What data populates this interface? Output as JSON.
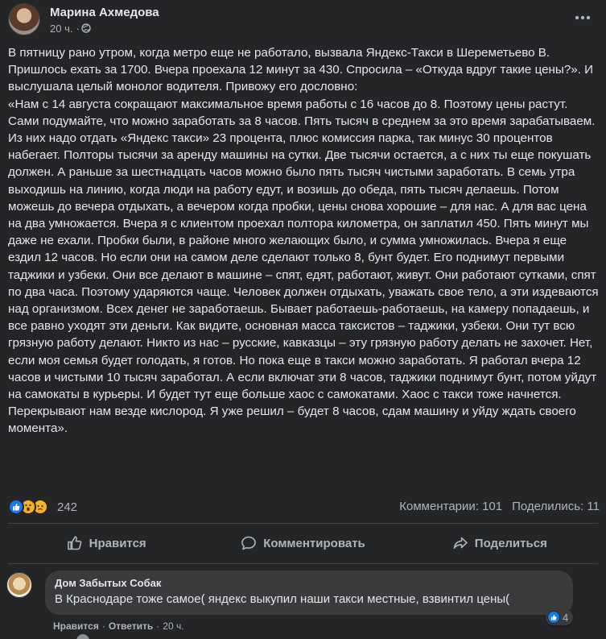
{
  "post": {
    "author": "Марина Ахмедова",
    "time": "20 ч.",
    "time_separator": "·",
    "more_icon": "more-horizontal-icon",
    "paragraphs": [
      "В пятницу рано утром, когда метро еще не работало, вызвала Яндекс-Такси в Шереметьево В. Пришлось ехать за 1700. Вчера проехала 12 минут за 430. Спросила – «Откуда вдруг такие цены?». И выслушала целый монолог водителя. Привожу его дословно:",
      "«Нам с 14 августа сокращают максимальное время работы с 16 часов до 8. Поэтому цены растут. Сами подумайте, что можно заработать за 8 часов. Пять тысяч в среднем за это время зарабатываем. Из них надо отдать «Яндекс такси» 23 процента, плюс комиссия парка, так минус 30 процентов набегает. Полторы тысячи за аренду машины на сутки. Две тысячи остается, а с них ты еще покушать должен. А раньше за шестнадцать часов можно было пять тысяч чистыми заработать. В семь утра выходишь на линию, когда люди на работу едут, и возишь до обеда, пять тысяч делаешь. Потом можешь до вечера отдыхать, а вечером когда пробки, цены снова хорошие – для нас. А для вас цена на два умножается. Вчера я с клиентом проехал полтора километра, он заплатил 450. Пять минут мы даже не ехали. Пробки были, в районе много желающих было, и сумма умножилась. Вчера я еще ездил 12 часов. Но если они на самом деле сделают только 8, бунт будет. Его поднимут первыми таджики и узбеки. Они все делают в машине – спят, едят, работают, живут. Они работают сутками, спят по два часа. Поэтому ударяются чаще. Человек должен отдыхать, уважать свое тело, а эти издеваются над организмом. Всех денег не заработаешь. Бывает работаешь-работаешь, на камеру попадаешь, и все равно уходят эти деньги. Как видите, основная масса таксистов – таджики, узбеки. Они тут всю грязную работу делают. Никто из нас – русские, кавказцы – эту грязную работу делать не захочет. Нет, если моя семья будет голодать, я готов. Но пока еще в такси можно заработать. Я работал вчера 12 часов и чистыми 10 тысяч заработал. А если включат эти 8 часов, таджики поднимут бунт, потом уйдут на самокаты в курьеры. И будет тут еще больше хаос с самокатами. Хаос с такси тоже начнется. Перекрывают нам везде кислород. Я уже решил – будет 8 часов, сдам машину и уйду ждать своего момента»."
    ],
    "reactions": {
      "icons": [
        "like-reaction-icon",
        "wow-reaction-icon",
        "sad-reaction-icon"
      ],
      "count": "242"
    },
    "stats": {
      "comments": "Комментарии: 101",
      "shares": "Поделились: 11"
    },
    "actions": {
      "like": "Нравится",
      "comment": "Комментировать",
      "share": "Поделиться"
    }
  },
  "comment": {
    "author": "Дом Забытых Собак",
    "text": "В Краснодаре тоже самое( яндекс выкупил наши такси местные, взвинтил цены(",
    "reaction_count": "4",
    "like_label": "Нравится",
    "reply_label": "Ответить",
    "separator": "·",
    "time": "20 ч."
  },
  "colors": {
    "background": "#242526",
    "text": "#e4e6eb",
    "secondary_text": "#b0b3b8",
    "bubble": "#3a3b3c",
    "like_blue": "#1877f2",
    "reaction_yellow": "#f7b125"
  }
}
